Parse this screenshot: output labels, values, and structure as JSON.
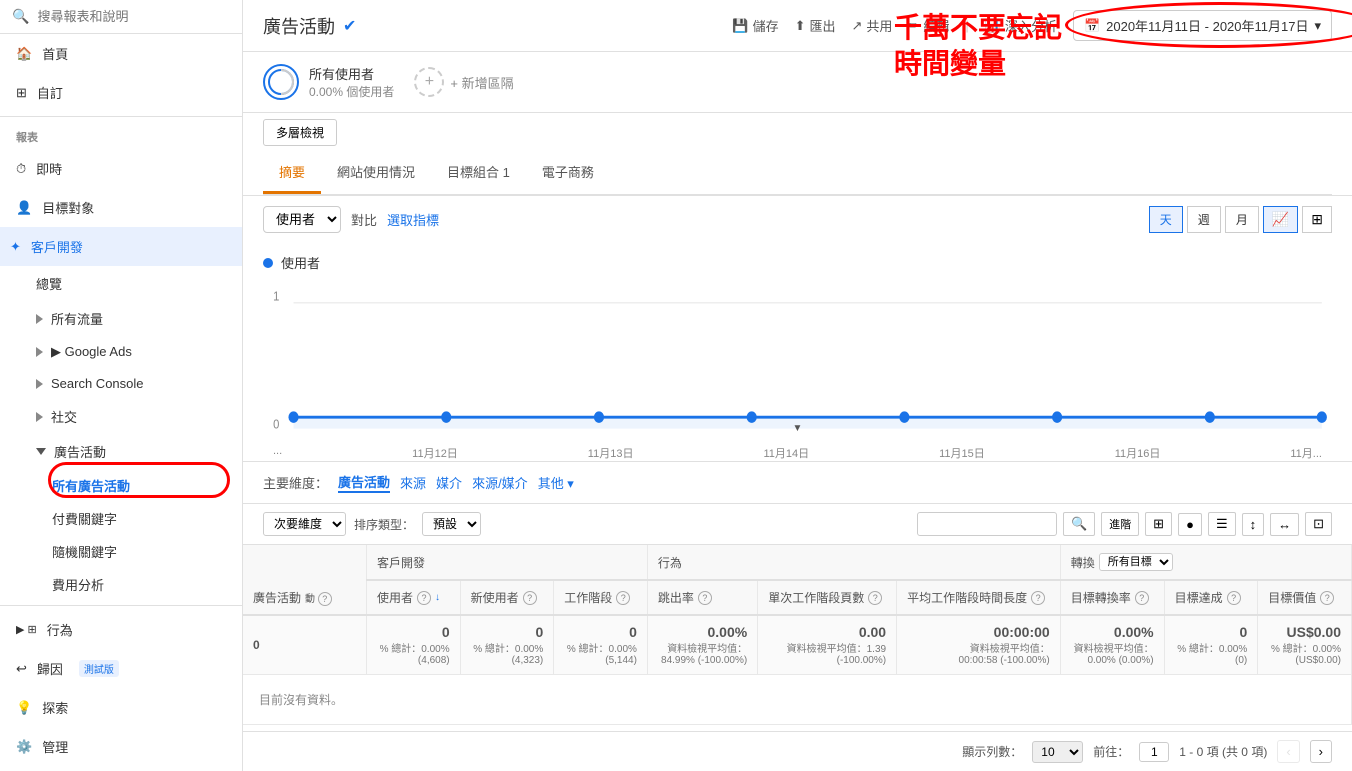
{
  "sidebar": {
    "search_placeholder": "搜尋報表和說明",
    "nav_items": [
      {
        "id": "home",
        "label": "首頁",
        "icon": "🏠"
      },
      {
        "id": "customize",
        "label": "自訂",
        "icon": "⊞"
      }
    ],
    "reports_label": "報表",
    "report_items": [
      {
        "id": "realtime",
        "label": "即時",
        "icon": "⏰"
      },
      {
        "id": "audience",
        "label": "目標對象",
        "icon": "👤"
      },
      {
        "id": "acquisition",
        "label": "客戶開發",
        "icon": "✦",
        "expanded": true,
        "children": [
          {
            "id": "overview",
            "label": "總覽"
          },
          {
            "id": "all-traffic",
            "label": "▶ 所有流量",
            "expanded": false
          },
          {
            "id": "google-ads",
            "label": "▶ Google Ads",
            "expanded": false
          },
          {
            "id": "search-console",
            "label": "▶ Search Console",
            "expanded": false
          },
          {
            "id": "social",
            "label": "▶ 社交",
            "expanded": false
          },
          {
            "id": "campaigns",
            "label": "▼ 廣告活動",
            "expanded": true,
            "children": [
              {
                "id": "all-campaigns",
                "label": "所有廣告活動",
                "active": true
              },
              {
                "id": "paid-keywords",
                "label": "付費關鍵字"
              },
              {
                "id": "organic-keywords",
                "label": "隨機關鍵字"
              },
              {
                "id": "cost-analysis",
                "label": "費用分析"
              }
            ]
          }
        ]
      },
      {
        "id": "behavior",
        "label": "行為",
        "icon": "▶"
      },
      {
        "id": "attribution",
        "label": "歸因",
        "icon": "↩",
        "badge": "測試版"
      },
      {
        "id": "explore",
        "label": "探索",
        "icon": "💡"
      },
      {
        "id": "admin",
        "label": "管理",
        "icon": "⚙️"
      }
    ]
  },
  "header": {
    "title": "廣告活動",
    "verified": true,
    "actions": [
      "儲存",
      "匯出",
      "共用",
      "編輯",
      "深入分析"
    ]
  },
  "date_range": "2020年11月11日 - 2020年11月17日",
  "annotation": {
    "text_line1": "千萬不要忘記",
    "text_line2": "時間變量"
  },
  "segments": {
    "segment1_name": "所有使用者",
    "segment1_pct": "0.00% 個使用者",
    "add_segment_label": "+ 新增區隔"
  },
  "view_toggle": "多層檢視",
  "tabs": [
    "摘要",
    "網站使用情況",
    "目標組合 1",
    "電子商務"
  ],
  "active_tab": "摘要",
  "chart": {
    "metric_label": "使用者",
    "compare_label": "對比",
    "select_metric_label": "選取指標",
    "period_buttons": [
      "天",
      "週",
      "月"
    ],
    "active_period": "天",
    "chart_type_buttons": [
      "📈",
      "⊞"
    ],
    "active_chart_type": "📈",
    "legend": "使用者",
    "y_axis_max": "1",
    "y_axis_min": "0",
    "x_labels": [
      "...",
      "11月12日",
      "11月13日",
      "11月14日",
      "11月15日",
      "11月16日",
      "11月..."
    ]
  },
  "dimensions": {
    "label": "主要維度：",
    "items": [
      "廣告活動",
      "來源",
      "媒介",
      "來源/媒介",
      "其他"
    ],
    "active": "廣告活動"
  },
  "table_controls": {
    "secondary_dim_label": "次要維度",
    "sort_type_label": "排序類型：",
    "sort_options": [
      "預設"
    ],
    "search_placeholder": ""
  },
  "table": {
    "col_groups": [
      {
        "label": "廣告活動",
        "span": 1
      },
      {
        "label": "客戶開發",
        "span": 3
      },
      {
        "label": "行為",
        "span": 2
      },
      {
        "label": "轉換",
        "span": 4
      }
    ],
    "conversion_goal": "所有目標",
    "columns": [
      {
        "id": "campaign",
        "label": "廣告活動",
        "sortable": false
      },
      {
        "id": "users",
        "label": "使用者",
        "info": true,
        "sort_dir": "desc"
      },
      {
        "id": "new_users",
        "label": "新使用者",
        "info": true
      },
      {
        "id": "sessions",
        "label": "工作階段",
        "info": true
      },
      {
        "id": "bounce_rate",
        "label": "跳出率",
        "info": true
      },
      {
        "id": "pages_per_session",
        "label": "單次工作階段頁數",
        "info": true
      },
      {
        "id": "avg_session_duration",
        "label": "平均工作階段時間長度",
        "info": true
      },
      {
        "id": "goal_conversion_rate",
        "label": "目標轉換率",
        "info": true
      },
      {
        "id": "goal_completions",
        "label": "目標達成",
        "info": true
      },
      {
        "id": "goal_value",
        "label": "目標價值",
        "info": true
      }
    ],
    "totals": {
      "users": "0",
      "new_users": "0",
      "sessions": "0",
      "bounce_rate": "0.00%",
      "pages_per_session": "0.00",
      "avg_session_duration": "00:00:00",
      "goal_conversion_rate": "0.00%",
      "goal_completions": "0",
      "goal_value": "US$0.00"
    },
    "totals_sub": {
      "users": "% 總計：0.00% (4,608)",
      "new_users": "% 總計：0.00% (4,323)",
      "sessions": "% 總計：0.00% (5,144)",
      "bounce_rate": "資料檢視平均值：84.99% (-100.00%)",
      "pages_per_session": "資料檢視平均值：1.39 (-100.00%)",
      "avg_session_duration": "資料檢視平均值：00:00:58 (-100.00%)",
      "goal_conversion_rate": "資料檢視平均值：0.00% (0.00%)",
      "goal_completions": "% 總計：0.00% (0)",
      "goal_value": "% 總計：0.00% (US$0.00)"
    },
    "no_data_message": "目前沒有資料。",
    "rows": []
  },
  "pagination": {
    "show_label": "顯示列數：",
    "per_page": "10",
    "per_page_options": [
      "10",
      "25",
      "50",
      "100"
    ],
    "prev_label": "前往：",
    "page_input": "1",
    "range_label": "1 - 0 項 (共 0 項)",
    "prev_btn": "‹",
    "next_btn": "›"
  }
}
